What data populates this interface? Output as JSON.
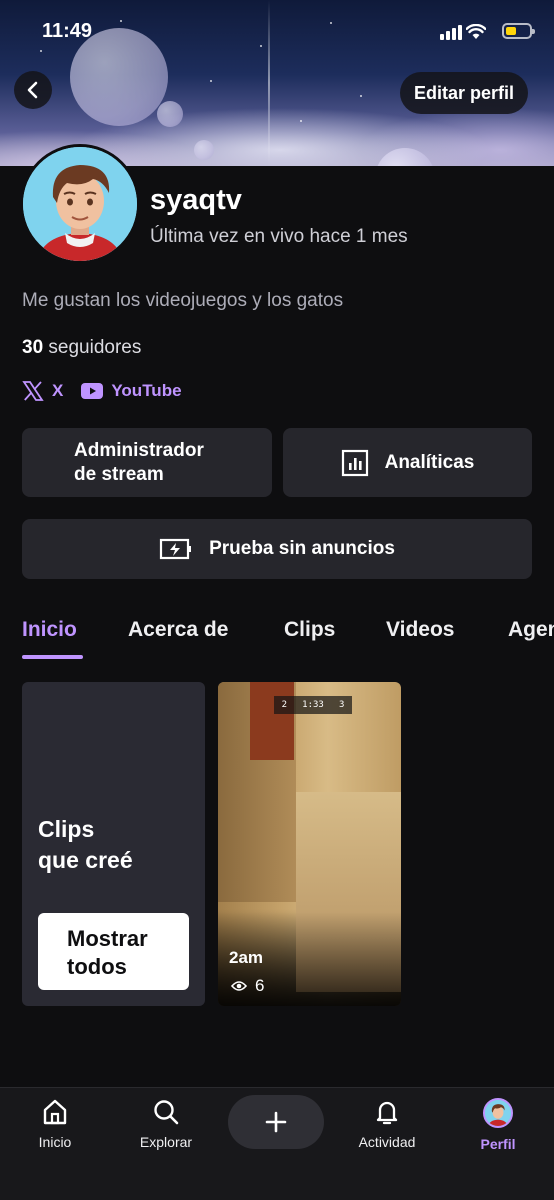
{
  "status_bar": {
    "time": "11:49"
  },
  "header": {
    "edit_label": "Editar perfil"
  },
  "profile": {
    "username": "syaqtv",
    "last_live": "Última vez en vivo hace 1 mes",
    "bio": "Me gustan los videojuegos y los gatos",
    "followers_count": "30",
    "followers_label": "seguidores",
    "socials": [
      {
        "name": "X",
        "icon": "x-logo-icon"
      },
      {
        "name": "YouTube",
        "icon": "youtube-icon"
      }
    ]
  },
  "actions": {
    "stream_manager": "Administrador\nde stream",
    "analytics": "Analíticas",
    "no_ads": "Prueba sin anuncios"
  },
  "tabs": [
    "Inicio",
    "Acerca de",
    "Clips",
    "Videos",
    "Agenda"
  ],
  "active_tab": "Inicio",
  "clips_section": {
    "title": "Clips\nque creé",
    "show_all": "Mostrar\ntodos",
    "clip": {
      "title": "2am",
      "views": "6",
      "hud_left": "2",
      "hud_time": "1:33",
      "hud_right": "3"
    }
  },
  "bottom_nav": [
    {
      "label": "Inicio",
      "icon": "home-icon"
    },
    {
      "label": "Explorar",
      "icon": "search-icon"
    },
    {
      "label": "",
      "icon": "plus-icon"
    },
    {
      "label": "Actividad",
      "icon": "bell-icon"
    },
    {
      "label": "Perfil",
      "icon": "avatar",
      "active": true
    }
  ],
  "colors": {
    "accent": "#bf94ff",
    "background": "#0e0e10",
    "button": "#26262c"
  }
}
